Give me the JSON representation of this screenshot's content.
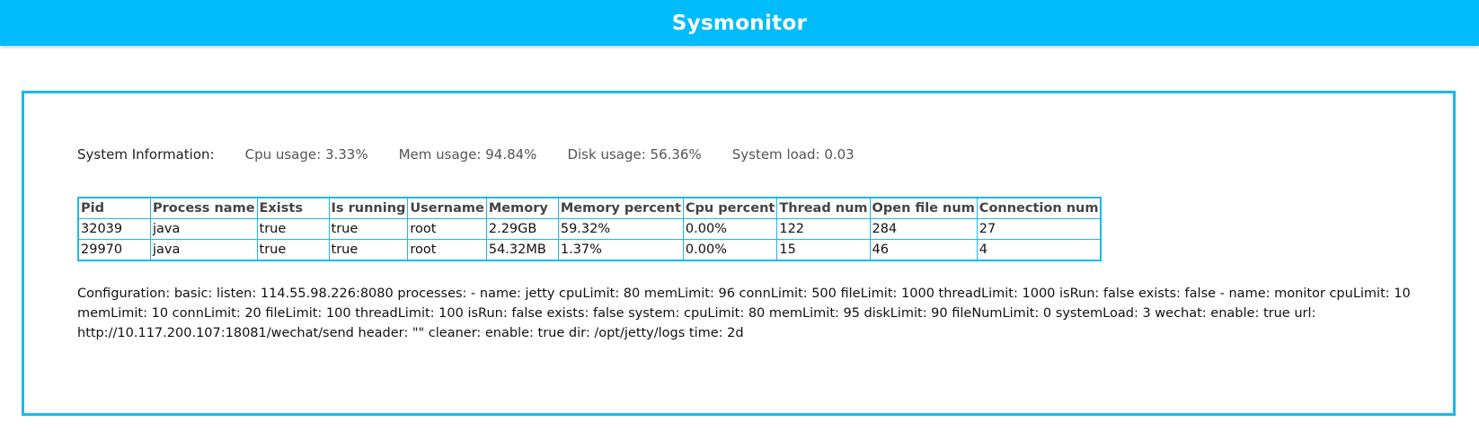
{
  "app": {
    "title": "Sysmonitor"
  },
  "system_info": {
    "label": "System Information:",
    "cpu": "Cpu usage: 3.33%",
    "mem": "Mem usage: 94.84%",
    "disk": "Disk usage: 56.36%",
    "load": "System load: 0.03"
  },
  "table": {
    "headers": [
      "Pid",
      "Process name",
      "Exists",
      "Is running",
      "Username",
      "Memory",
      "Memory percent",
      "Cpu percent",
      "Thread num",
      "Open file num",
      "Connection num"
    ],
    "rows": [
      [
        "32039",
        "java",
        "true",
        "true",
        "root",
        "2.29GB",
        "59.32%",
        "0.00%",
        "122",
        "284",
        "27"
      ],
      [
        "29970",
        "java",
        "true",
        "true",
        "root",
        "54.32MB",
        "1.37%",
        "0.00%",
        "15",
        "46",
        "4"
      ]
    ]
  },
  "configuration": "Configuration: basic: listen: 114.55.98.226:8080 processes: - name: jetty cpuLimit: 80 memLimit: 96 connLimit: 500 fileLimit: 1000 threadLimit: 1000 isRun: false exists: false - name: monitor cpuLimit: 10 memLimit: 10 connLimit: 20 fileLimit: 100 threadLimit: 100 isRun: false exists: false system: cpuLimit: 80 memLimit: 95 diskLimit: 90 fileNumLimit: 0 systemLoad: 3 wechat: enable: true url: http://10.117.200.107:18081/wechat/send header: \"\" cleaner: enable: true dir: /opt/jetty/logs time: 2d",
  "colors": {
    "header_bg": "#00bcfa",
    "border": "#1ab8f0"
  }
}
